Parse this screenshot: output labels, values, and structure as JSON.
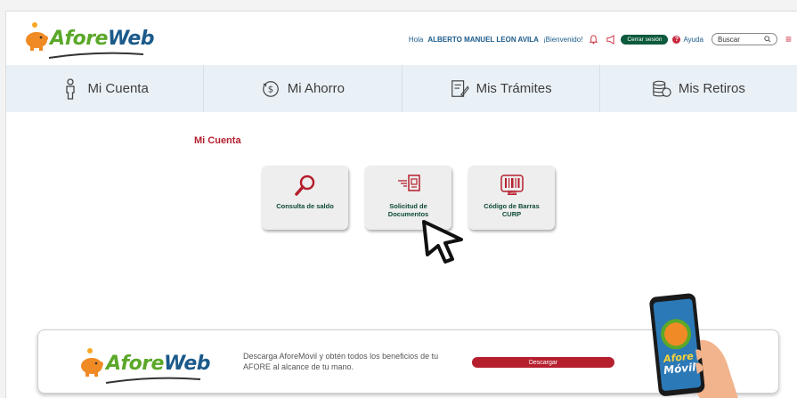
{
  "header": {
    "logo": {
      "part1": "Afore",
      "part2": "Web"
    },
    "greeting_prefix": "Hola",
    "user_name": "ALBERTO MANUEL LEON AVILA",
    "greeting_suffix": "¡Bienvenido!",
    "logout_label": "Cerrar sesión",
    "help_label": "Ayuda",
    "search_placeholder": "Buscar",
    "icons": [
      "bell-icon",
      "megaphone-icon",
      "help-icon",
      "search-icon",
      "hamburger-menu-icon"
    ]
  },
  "nav": {
    "items": [
      {
        "label": "Mi Cuenta",
        "icon": "person-icon"
      },
      {
        "label": "Mi Ahorro",
        "icon": "piggy-bank-icon"
      },
      {
        "label": "Mis Trámites",
        "icon": "document-pen-icon"
      },
      {
        "label": "Mis Retiros",
        "icon": "coins-stack-icon"
      }
    ]
  },
  "main": {
    "section_title": "Mi Cuenta",
    "cards": [
      {
        "label": "Consulta de saldo",
        "icon": "magnifier-icon"
      },
      {
        "label": "Solicitud de\nDocumentos",
        "icon": "document-send-icon"
      },
      {
        "label": "Código de Barras\nCURP",
        "icon": "barcode-curp-icon"
      }
    ]
  },
  "banner": {
    "logo": {
      "part1": "Afore",
      "part2": "Web"
    },
    "text": "Descarga AforeMóvil y obtén todos los beneficios de tu AFORE al alcance de tu mano.",
    "download_label": "Descargar",
    "phone_text": "Afore\nMóvil"
  },
  "colors": {
    "brand_green": "#5ba829",
    "brand_blue": "#1b5a8a",
    "accent_red": "#b51f2e",
    "dark_green": "#0d5a3c",
    "nav_bg": "#eaf1f6"
  }
}
